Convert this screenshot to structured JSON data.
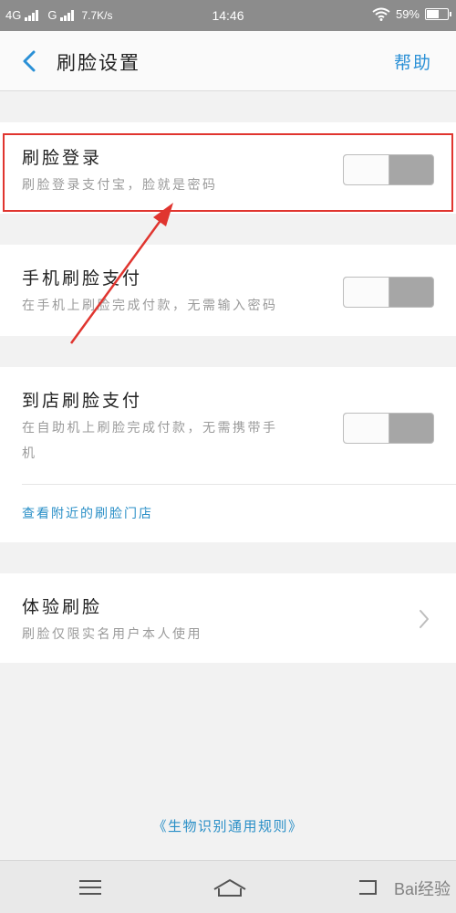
{
  "status_bar": {
    "network1": "4G",
    "network2": "G",
    "speed": "7.7K/s",
    "time": "14:46",
    "battery": "59%",
    "battery_level": 0.59
  },
  "header": {
    "back_icon": "chevron-left-icon",
    "title": "刷脸设置",
    "help_label": "帮助"
  },
  "settings": [
    {
      "title": "刷脸登录",
      "subtitle": "刷脸登录支付宝，脸就是密码",
      "toggle_on": false
    },
    {
      "title": "手机刷脸支付",
      "subtitle": "在手机上刷脸完成付款，无需输入密码",
      "toggle_on": false
    },
    {
      "title": "到店刷脸支付",
      "subtitle_line1": "在自助机上刷脸完成付款，无需携带手",
      "subtitle_line2": "机",
      "toggle_on": false,
      "link": "查看附近的刷脸门店"
    },
    {
      "title": "体验刷脸",
      "subtitle": "刷脸仅限实名用户本人使用"
    }
  ],
  "rules_link": "《生物识别通用规则》",
  "nav_icons": [
    "menu-icon",
    "home-icon",
    "back-icon"
  ],
  "watermark": "Bai经验",
  "colors": {
    "accent": "#2a90d6",
    "highlight": "#e0352f",
    "status_bar": "#8c8c8c"
  }
}
